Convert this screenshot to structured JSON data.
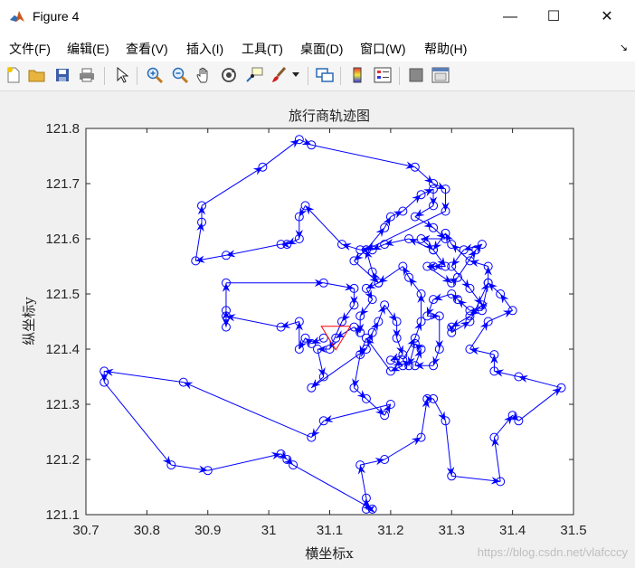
{
  "window": {
    "title": "Figure 4",
    "minimize_glyph": "—",
    "maximize_glyph": "☐",
    "close_glyph": "✕"
  },
  "menu": {
    "items": [
      "文件(F)",
      "编辑(E)",
      "查看(V)",
      "插入(I)",
      "工具(T)",
      "桌面(D)",
      "窗口(W)",
      "帮助(H)"
    ],
    "overflow_glyph": "↘"
  },
  "toolbar": {
    "icons": [
      "new-figure-icon",
      "open-file-icon",
      "save-icon",
      "print-icon",
      "pointer-icon",
      "zoom-in-icon",
      "zoom-out-icon",
      "pan-icon",
      "rotate-3d-icon",
      "data-cursor-icon",
      "brush-icon",
      "link-plot-icon",
      "colorbar-icon",
      "legend-icon",
      "hide-plot-tools-icon",
      "show-plot-tools-icon"
    ]
  },
  "watermark": "https://blog.csdn.net/vlafcccy",
  "colors": {
    "path": "#0000ff",
    "start_marker": "#ff0000",
    "axes": "#262626"
  },
  "chart_data": {
    "type": "line",
    "title": "旅行商轨迹图",
    "xlabel": "横坐标x",
    "ylabel": "纵坐标y",
    "xlim": [
      30.7,
      31.5
    ],
    "ylim": [
      121.1,
      121.8
    ],
    "xticks": [
      "30.7",
      "30.8",
      "30.9",
      "31",
      "31.1",
      "31.2",
      "31.3",
      "31.4",
      "31.5"
    ],
    "yticks": [
      "121.1",
      "121.2",
      "121.3",
      "121.4",
      "121.5",
      "121.6",
      "121.7",
      "121.8"
    ],
    "markers": "circle",
    "arrows": true,
    "start_point": [
      31.11,
      121.42
    ],
    "points": [
      [
        31.09,
        121.42
      ],
      [
        31.07,
        121.41
      ],
      [
        31.06,
        121.42
      ],
      [
        31.05,
        121.4
      ],
      [
        31.05,
        121.45
      ],
      [
        31.02,
        121.44
      ],
      [
        30.93,
        121.46
      ],
      [
        30.93,
        121.44
      ],
      [
        30.93,
        121.47
      ],
      [
        30.93,
        121.52
      ],
      [
        31.09,
        121.52
      ],
      [
        31.14,
        121.51
      ],
      [
        31.14,
        121.48
      ],
      [
        31.12,
        121.45
      ],
      [
        31.1,
        121.4
      ],
      [
        31.08,
        121.4
      ],
      [
        31.09,
        121.35
      ],
      [
        31.07,
        121.33
      ],
      [
        31.16,
        121.4
      ],
      [
        31.17,
        121.43
      ],
      [
        31.18,
        121.45
      ],
      [
        31.19,
        121.48
      ],
      [
        31.21,
        121.45
      ],
      [
        31.21,
        121.42
      ],
      [
        31.22,
        121.39
      ],
      [
        31.2,
        121.38
      ],
      [
        31.22,
        121.37
      ],
      [
        31.2,
        121.36
      ],
      [
        31.16,
        121.42
      ],
      [
        31.15,
        121.39
      ],
      [
        31.14,
        121.33
      ],
      [
        31.16,
        121.31
      ],
      [
        31.19,
        121.28
      ],
      [
        31.2,
        121.3
      ],
      [
        31.09,
        121.27
      ],
      [
        31.07,
        121.24
      ],
      [
        30.86,
        121.34
      ],
      [
        30.73,
        121.36
      ],
      [
        30.73,
        121.34
      ],
      [
        30.84,
        121.19
      ],
      [
        30.9,
        121.18
      ],
      [
        31.02,
        121.21
      ],
      [
        31.03,
        121.2
      ],
      [
        31.04,
        121.19
      ],
      [
        31.17,
        121.11
      ],
      [
        31.16,
        121.11
      ],
      [
        31.16,
        121.13
      ],
      [
        31.15,
        121.19
      ],
      [
        31.19,
        121.2
      ],
      [
        31.25,
        121.24
      ],
      [
        31.26,
        121.31
      ],
      [
        31.27,
        121.31
      ],
      [
        31.29,
        121.27
      ],
      [
        31.3,
        121.17
      ],
      [
        31.38,
        121.16
      ],
      [
        31.37,
        121.24
      ],
      [
        31.4,
        121.28
      ],
      [
        31.41,
        121.27
      ],
      [
        31.48,
        121.33
      ],
      [
        31.41,
        121.35
      ],
      [
        31.37,
        121.36
      ],
      [
        31.37,
        121.39
      ],
      [
        31.33,
        121.4
      ],
      [
        31.36,
        121.45
      ],
      [
        31.4,
        121.47
      ],
      [
        31.38,
        121.5
      ],
      [
        31.36,
        121.52
      ],
      [
        31.35,
        121.47
      ],
      [
        31.33,
        121.47
      ],
      [
        31.31,
        121.49
      ],
      [
        31.3,
        121.5
      ],
      [
        31.27,
        121.49
      ],
      [
        31.26,
        121.46
      ],
      [
        31.28,
        121.46
      ],
      [
        31.28,
        121.4
      ],
      [
        31.27,
        121.37
      ],
      [
        31.24,
        121.37
      ],
      [
        31.25,
        121.4
      ],
      [
        31.24,
        121.41
      ],
      [
        31.23,
        121.37
      ],
      [
        31.22,
        121.38
      ],
      [
        31.24,
        121.42
      ],
      [
        31.25,
        121.45
      ],
      [
        31.25,
        121.5
      ],
      [
        31.23,
        121.53
      ],
      [
        31.22,
        121.55
      ],
      [
        31.18,
        121.52
      ],
      [
        31.17,
        121.54
      ],
      [
        31.16,
        121.58
      ],
      [
        31.19,
        121.62
      ],
      [
        31.2,
        121.64
      ],
      [
        31.22,
        121.65
      ],
      [
        31.25,
        121.68
      ],
      [
        31.27,
        121.69
      ],
      [
        31.27,
        121.66
      ],
      [
        31.24,
        121.64
      ],
      [
        31.27,
        121.62
      ],
      [
        31.29,
        121.6
      ],
      [
        31.25,
        121.6
      ],
      [
        31.27,
        121.58
      ],
      [
        31.29,
        121.55
      ],
      [
        31.27,
        121.55
      ],
      [
        31.26,
        121.55
      ],
      [
        31.3,
        121.52
      ],
      [
        31.31,
        121.53
      ],
      [
        31.34,
        121.58
      ],
      [
        31.35,
        121.59
      ],
      [
        31.32,
        121.58
      ],
      [
        31.3,
        121.55
      ],
      [
        31.33,
        121.51
      ],
      [
        31.35,
        121.48
      ],
      [
        31.33,
        121.46
      ],
      [
        31.3,
        121.44
      ],
      [
        31.3,
        121.43
      ],
      [
        31.33,
        121.45
      ],
      [
        31.36,
        121.52
      ],
      [
        31.36,
        121.55
      ],
      [
        31.33,
        121.56
      ],
      [
        31.3,
        121.59
      ],
      [
        31.29,
        121.61
      ],
      [
        31.27,
        121.58
      ],
      [
        31.23,
        121.6
      ],
      [
        31.19,
        121.59
      ],
      [
        31.17,
        121.58
      ],
      [
        31.15,
        121.58
      ],
      [
        31.12,
        121.59
      ],
      [
        31.06,
        121.66
      ],
      [
        31.05,
        121.64
      ],
      [
        31.05,
        121.6
      ],
      [
        31.03,
        121.59
      ],
      [
        31.02,
        121.59
      ],
      [
        30.93,
        121.57
      ],
      [
        30.88,
        121.56
      ],
      [
        30.89,
        121.63
      ],
      [
        30.89,
        121.66
      ],
      [
        30.99,
        121.73
      ],
      [
        31.05,
        121.78
      ],
      [
        31.07,
        121.77
      ],
      [
        31.24,
        121.73
      ],
      [
        31.27,
        121.7
      ],
      [
        31.29,
        121.69
      ],
      [
        31.29,
        121.65
      ],
      [
        31.16,
        121.58
      ],
      [
        31.14,
        121.56
      ],
      [
        31.18,
        121.52
      ],
      [
        31.16,
        121.51
      ],
      [
        31.17,
        121.49
      ],
      [
        31.15,
        121.46
      ],
      [
        31.15,
        121.43
      ],
      [
        31.14,
        121.44
      ],
      [
        31.11,
        121.42
      ]
    ]
  }
}
